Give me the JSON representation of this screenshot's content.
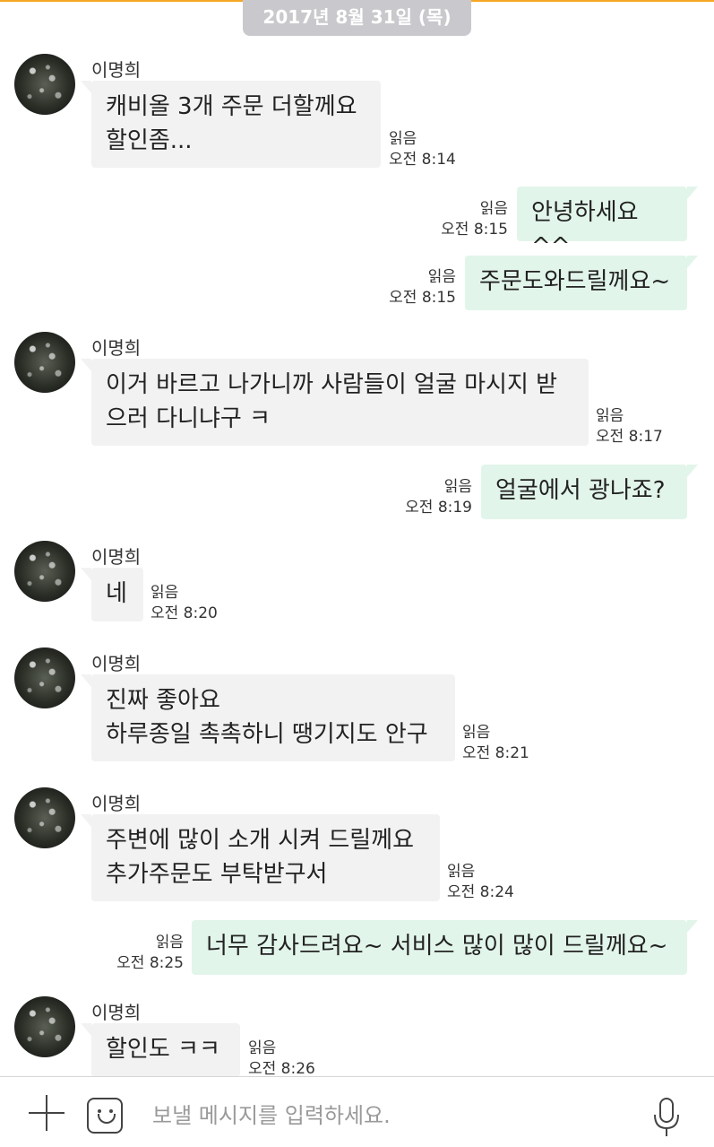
{
  "date_chip": "2017년 8월 31일 (목)",
  "messages": [
    {
      "sender": "이명희",
      "text": "캐비올 3개 주문 더할께요\n할인좀...",
      "read": "읽음",
      "time": "오전 8:14"
    },
    {
      "text": "안녕하세요 ^^",
      "read": "읽음",
      "time": "오전 8:15"
    },
    {
      "text": "주문도와드릴께요~",
      "read": "읽음",
      "time": "오전 8:15"
    },
    {
      "sender": "이명희",
      "text": "이거 바르고 나가니까 사람들이 얼굴 마시지 받\n으러 다니냐구 ㅋ",
      "read": "읽음",
      "time": "오전 8:17"
    },
    {
      "text": "얼굴에서 광나죠?",
      "read": "읽음",
      "time": "오전 8:19"
    },
    {
      "sender": "이명희",
      "text": "네",
      "read": "읽음",
      "time": "오전 8:20"
    },
    {
      "sender": "이명희",
      "text": "진짜 좋아요\n하루종일 촉촉하니 땡기지도 안구",
      "read": "읽음",
      "time": "오전 8:21"
    },
    {
      "sender": "이명희",
      "text": "주변에 많이 소개 시켜 드릴께요\n추가주문도 부탁받구서",
      "read": "읽음",
      "time": "오전 8:24"
    },
    {
      "text": "너무 감사드려요~ 서비스 많이 많이 드릴께요~",
      "read": "읽음",
      "time": "오전 8:25"
    },
    {
      "sender": "이명희",
      "text": "할인도 ㅋㅋ",
      "read": "읽음",
      "time": "오전 8:26"
    }
  ],
  "input": {
    "placeholder": "보낼 메시지를 입력하세요."
  },
  "icons": {
    "add": "plus-icon",
    "emoticon": "emoticon-icon",
    "voice": "microphone-icon"
  },
  "colors": {
    "incoming_bubble": "#f2f2f3",
    "outgoing_bubble": "#e2f5ea",
    "accent": "#f5a623"
  }
}
